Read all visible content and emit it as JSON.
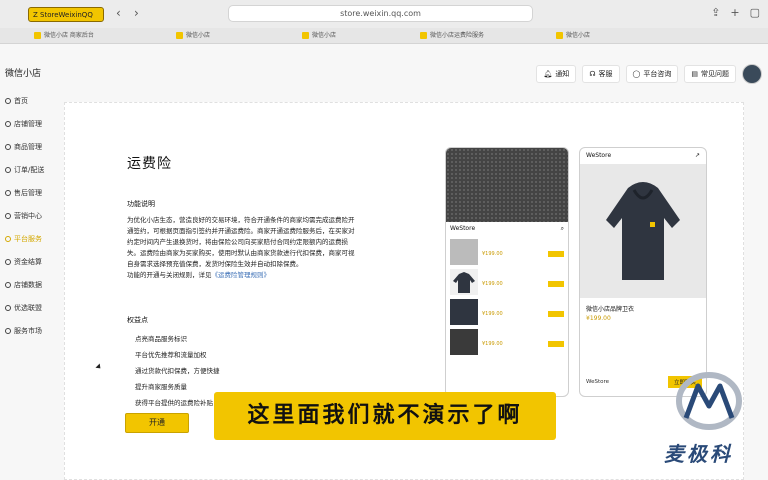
{
  "browser": {
    "pill_label": "Z StoreWeixinQQ",
    "url": "store.weixin.qq.com",
    "tabs": [
      "微信小店 商家后台",
      "微信小店",
      "微信小店",
      "微信小店运费险服务",
      "微信小店"
    ]
  },
  "app": {
    "brand": "微信小店",
    "header": [
      "通知",
      "客服",
      "平台咨询",
      "常见问题"
    ],
    "sidebar": [
      "首页",
      "店铺管理",
      "商品管理",
      "订单/配送",
      "售后管理",
      "营销中心",
      "平台服务",
      "资金结算",
      "店铺数据",
      "优选联盟",
      "服务市场"
    ],
    "active_sidebar_index": 6
  },
  "content": {
    "title": "运费险",
    "section_func": "功能说明",
    "description": "为优化小店生态，营造良好的交易环境，符合开通条件的商家均需完成运费险开通签约，可根据页面指引签约并开通运费险。商家开通运费险服务后，在买家对约定时间内产生退换货时，将由保险公司向买家赔付合同约定限额内的运费损失。运费险由商家为买家购买，使用时默认由商家货款进行代扣保费，商家可视自身需求选择预充值保费，发货时保险生效并自动扣除保费。",
    "description_link_prefix": "功能的开通与关闭规则，详见",
    "description_link": "《运费险管理规则》",
    "section_rights": "权益点",
    "rights": [
      "点亮商品服务标识",
      "平台优先推荐和流量加权",
      "通过货款代扣保费，方便快捷",
      "提升商家服务质量",
      "获得平台提供的运费险补贴"
    ],
    "open_button": "开通"
  },
  "mockup": {
    "store_name": "WeStore",
    "product_name": "微信小店品牌卫衣",
    "product_price": "¥199.00",
    "buy_label": "立即购买"
  },
  "overlay": {
    "subtitle": "这里面我们就不演示了啊",
    "watermark": "麦极科"
  }
}
